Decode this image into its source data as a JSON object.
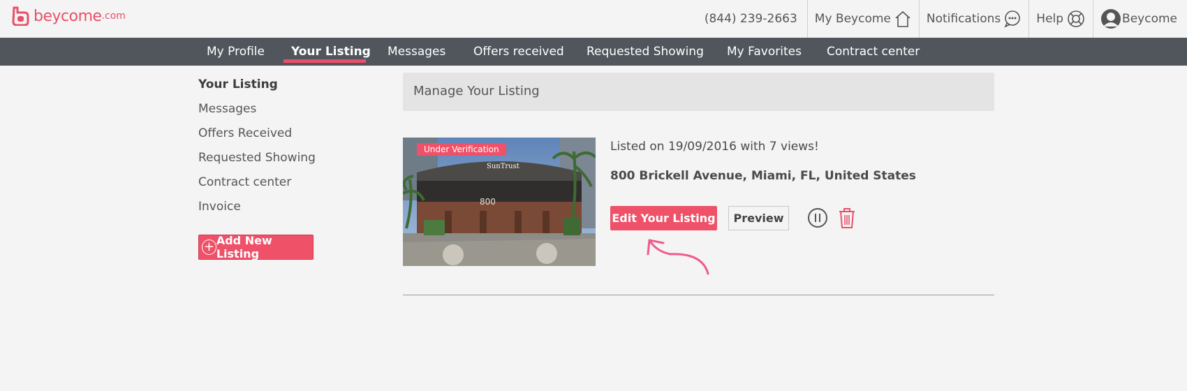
{
  "brand": {
    "name": "beycome",
    "domain": ".com",
    "color": "#e8506a"
  },
  "topbar": {
    "phone": "(844) 239-2663",
    "my_beycome": "My Beycome",
    "notifications": "Notifications",
    "help": "Help",
    "user": "Beycome"
  },
  "nav": {
    "items": [
      "My Profile",
      "Your Listing",
      "Messages",
      "Offers received",
      "Requested Showing",
      "My Favorites",
      "Contract center"
    ],
    "active": "Your Listing"
  },
  "sidebar": {
    "items": [
      "Your Listing",
      "Messages",
      "Offers Received",
      "Requested Showing",
      "Contract center",
      "Invoice"
    ],
    "add_button": "Add New Listing"
  },
  "main": {
    "header": "Manage Your Listing",
    "listing": {
      "status_badge": "Under Verification",
      "listed_on": "Listed on 19/09/2016 with 7 views!",
      "address": "800 Brickell Avenue, Miami, FL, United States",
      "edit_button": "Edit Your Listing",
      "preview_button": "Preview",
      "building_sign": "SunTrust",
      "building_number": "800"
    }
  },
  "icons": {
    "home": "home-icon",
    "notifications": "chat-bubble-icon",
    "help": "lifebuoy-icon",
    "user": "user-avatar-icon",
    "pause": "pause-icon",
    "delete": "trash-icon",
    "add": "plus-circle-icon"
  },
  "colors": {
    "accent": "#ef5169",
    "nav_bg": "#50565c",
    "page_bg": "#f4f4f4"
  }
}
